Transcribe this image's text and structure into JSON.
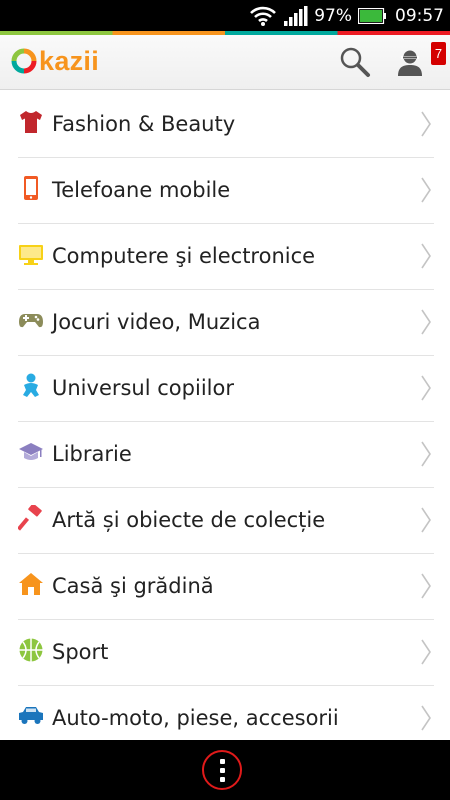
{
  "status_bar": {
    "battery_percent": "97%",
    "time": "09:57",
    "icons": [
      "wifi-icon",
      "signal-icon",
      "battery-icon"
    ]
  },
  "header": {
    "logo_text": "kazii",
    "notification_count": "7",
    "icons": [
      "search-icon",
      "account-icon"
    ]
  },
  "categories": [
    {
      "label": "Fashion & Beauty",
      "icon": "tshirt-icon",
      "color": "#c1272d"
    },
    {
      "label": "Telefoane mobile",
      "icon": "phone-icon",
      "color": "#f15a24"
    },
    {
      "label": "Computere şi electronice",
      "icon": "monitor-icon",
      "color": "#f7d117"
    },
    {
      "label": "Jocuri video, Muzica",
      "icon": "gamepad-icon",
      "color": "#8c8c5a"
    },
    {
      "label": "Universul copiilor",
      "icon": "baby-icon",
      "color": "#29abe2"
    },
    {
      "label": "Librarie",
      "icon": "graduation-cap-icon",
      "color": "#8b7fc0"
    },
    {
      "label": "Artă și obiecte de colecție",
      "icon": "hammer-icon",
      "color": "#e8434d"
    },
    {
      "label": "Casă şi grădină",
      "icon": "house-icon",
      "color": "#f7941d"
    },
    {
      "label": "Sport",
      "icon": "ball-icon",
      "color": "#8dc63f"
    },
    {
      "label": "Auto-moto, piese, accesorii",
      "icon": "car-icon",
      "color": "#1b75bc"
    }
  ],
  "bottom_bar": {
    "icon": "overflow-menu-icon"
  }
}
